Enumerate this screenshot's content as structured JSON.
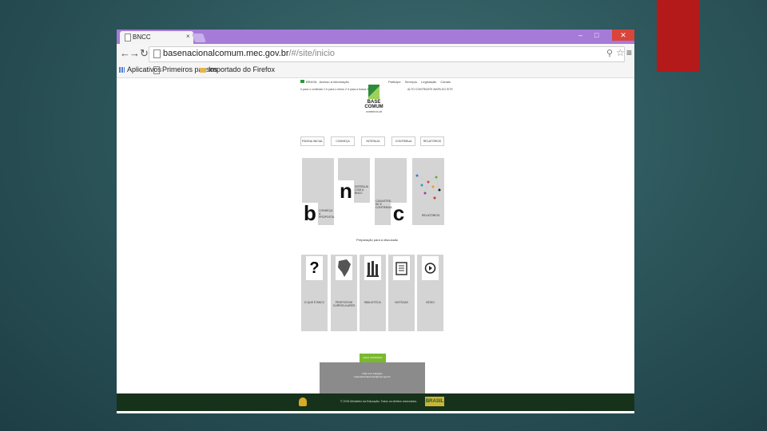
{
  "browser": {
    "tab_title": "BNCC",
    "tab_close": "×",
    "url_host": "basenacionalcomum.mec.gov.br",
    "url_path": "/#/site/inicio",
    "win_min": "–",
    "win_max": "□",
    "win_close": "✕",
    "bookmarks": [
      "Aplicativos",
      "Primeiros passos",
      "Importado do Firefox"
    ]
  },
  "site": {
    "gov_bar": {
      "brasil": "BRASIL",
      "info": "Acesso à informação",
      "links": [
        "Participe",
        "Serviços",
        "Legislação",
        "Canais"
      ]
    },
    "sub_left": "Ir para o conteúdo 1  Ir para o menu 2  Ir para a busca 3",
    "sub_right": "ALTO CONTRASTE  MAPA DO SITE",
    "logo_line1": "BASE",
    "logo_line2": "COMUM",
    "logo_sub": "CURRICULAR",
    "nav": [
      "PÁGINA INICIAL",
      "CONHEÇA",
      "INTERAJA",
      "CONTRIBUA",
      "RELATÓRIOS"
    ],
    "hero": [
      {
        "letter": "b",
        "label": "CONHEÇA A PROPOSTA"
      },
      {
        "letter": "n",
        "label": "INTERAJA COM A BNCC"
      },
      {
        "letter": "c",
        "label": "CADASTRE-SE E CONTRIBUA"
      },
      {
        "letter": "",
        "label": "RELATÓRIOS"
      }
    ],
    "caption": "Preparação para a discussão",
    "tiles": [
      {
        "icon": "?",
        "label": "O QUE É BNCC"
      },
      {
        "icon": "",
        "label": "PROPOSTAS CURRICULARES"
      },
      {
        "icon": "",
        "label": "BIBLIOTECA"
      },
      {
        "icon": "",
        "label": "NOTÍCIAS"
      },
      {
        "icon": "▶",
        "label": "VÍDEO"
      }
    ],
    "contact_btn": "FALE CONOSCO",
    "contact_lines": [
      "Fale com a Equipe",
      "basenacionalcomum@mec.gov.br"
    ],
    "footer_text": "© 2015 Ministério da Educação. Todos os direitos reservados.",
    "footer_brand": "BRASIL"
  }
}
